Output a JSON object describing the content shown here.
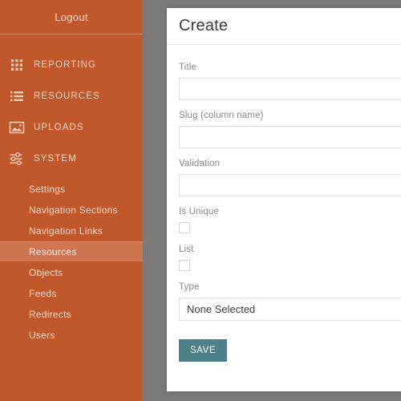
{
  "theme": {
    "sidebar_bg": "#c1582c",
    "sidebar_active_bg": "#cd7450",
    "sidebar_divider": "#d98b63",
    "overlay_bg": "#7b7b7b",
    "modal_bg": "#ffffff",
    "save_button_bg": "#4d8088",
    "label_color": "#8b8b8b",
    "input_border": "#e0e0e0"
  },
  "sidebar": {
    "logout_label": "Logout",
    "groups": [
      {
        "label": "REPORTING",
        "icon": "grid-icon"
      },
      {
        "label": "RESOURCES",
        "icon": "list-icon"
      },
      {
        "label": "UPLOADS",
        "icon": "image-icon"
      },
      {
        "label": "SYSTEM",
        "icon": "sliders-icon"
      }
    ],
    "system_items": [
      {
        "label": "Settings",
        "active": false
      },
      {
        "label": "Navigation Sections",
        "active": false
      },
      {
        "label": "Navigation Links",
        "active": false
      },
      {
        "label": "Resources",
        "active": true
      },
      {
        "label": "Objects",
        "active": false
      },
      {
        "label": "Feeds",
        "active": false
      },
      {
        "label": "Redirects",
        "active": false
      },
      {
        "label": "Users",
        "active": false
      }
    ]
  },
  "modal": {
    "title": "Create",
    "fields": {
      "title": {
        "label": "Title",
        "value": "",
        "placeholder": ""
      },
      "slug": {
        "label": "Slug (column name)",
        "value": "",
        "placeholder": ""
      },
      "validation": {
        "label": "Validation",
        "value": "",
        "placeholder": ""
      },
      "is_unique": {
        "label": "Is Unique",
        "checked": false
      },
      "list": {
        "label": "List",
        "checked": false
      },
      "type": {
        "label": "Type",
        "value": "None Selected"
      }
    },
    "save_label": "SAVE"
  }
}
